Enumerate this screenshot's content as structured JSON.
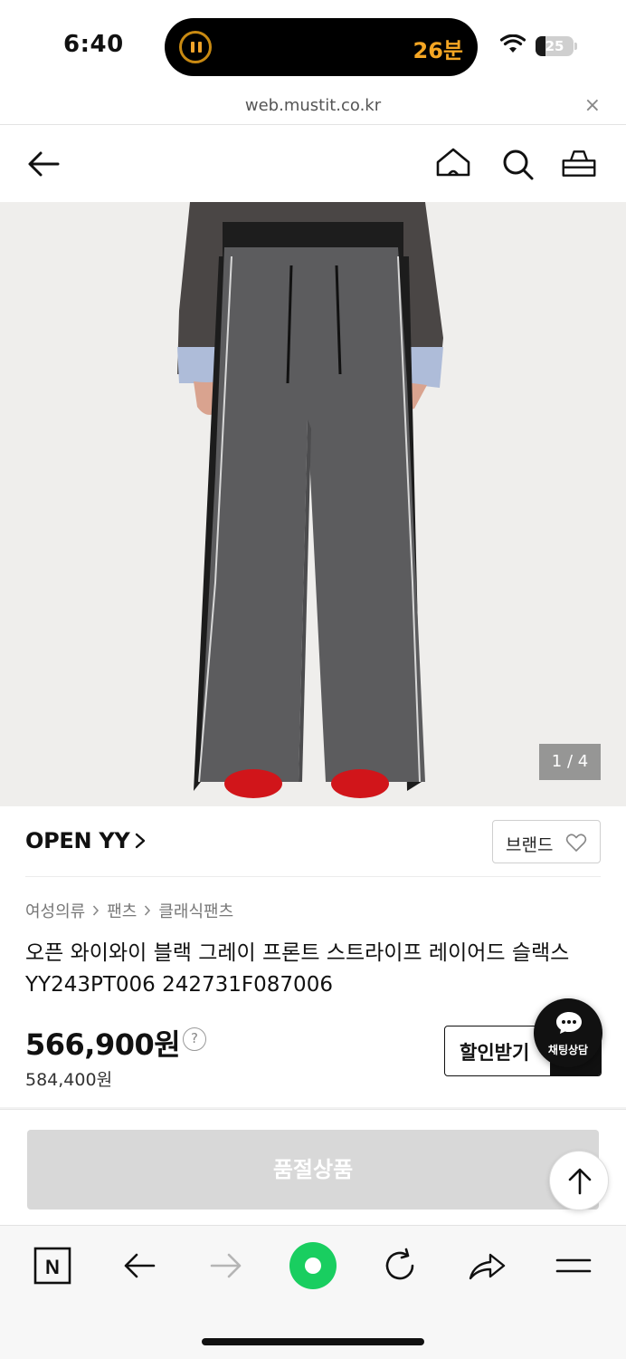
{
  "status_bar": {
    "time": "6:40",
    "timer": "26분",
    "battery": "25",
    "battery_level": 0.25
  },
  "url_bar": {
    "url": "web.mustit.co.kr",
    "close": "×"
  },
  "header": {
    "icons": [
      "back-arrow-icon",
      "home-icon",
      "search-icon",
      "cart-icon"
    ]
  },
  "product": {
    "image_counter": "1 / 4",
    "brand": "OPEN YY",
    "brand_button": "브랜드",
    "breadcrumb": [
      "여성의류",
      "팬츠",
      "클래식팬츠"
    ],
    "title_line1": "오픈 와이와이 블랙 그레이 프론트 스트라이프 레이어드 슬랙스",
    "title_line2": "YY243PT006 242731F087006",
    "price": "566,900원",
    "price_help": "?",
    "original_price": "584,400원",
    "discount_button": "할인받기"
  },
  "chat": {
    "label": "채팅상담"
  },
  "purchase": {
    "soldout_label": "품절상품"
  },
  "toolbar": {
    "n_label": "N",
    "icons": [
      "naver-n-icon",
      "back-arrow-icon",
      "forward-arrow-icon",
      "green-dot-icon",
      "reload-icon",
      "share-icon",
      "menu-icon"
    ]
  },
  "colors": {
    "accent_orange": "#f5a623",
    "naver_green": "#19ce60",
    "soldout_gray": "#d8d8d8"
  }
}
